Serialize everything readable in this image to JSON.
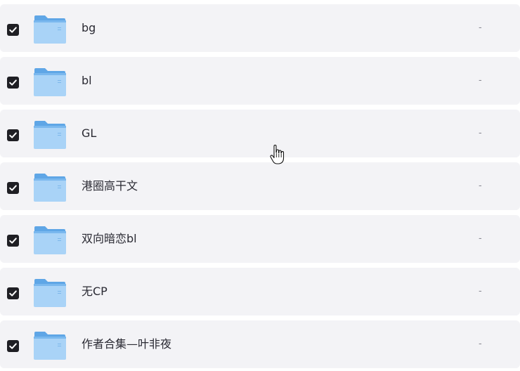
{
  "files": [
    {
      "name": "bg",
      "size": "-",
      "checked": true,
      "icon": "folder-icon"
    },
    {
      "name": "bl",
      "size": "-",
      "checked": true,
      "icon": "folder-icon"
    },
    {
      "name": "GL",
      "size": "-",
      "checked": true,
      "icon": "folder-icon"
    },
    {
      "name": "港圈高干文",
      "size": "-",
      "checked": true,
      "icon": "folder-icon"
    },
    {
      "name": "双向暗恋bl",
      "size": "-",
      "checked": true,
      "icon": "folder-icon"
    },
    {
      "name": "无CP",
      "size": "-",
      "checked": true,
      "icon": "folder-icon"
    },
    {
      "name": "作者合集—叶非夜",
      "size": "-",
      "checked": true,
      "icon": "folder-icon"
    }
  ],
  "colors": {
    "row_background": "#f3f3f6",
    "checkbox": "#1f1f24",
    "folder_light": "#a9d3f7",
    "folder_dark": "#5fa6e6"
  },
  "cursor": {
    "icon": "hand-pointer-icon"
  }
}
